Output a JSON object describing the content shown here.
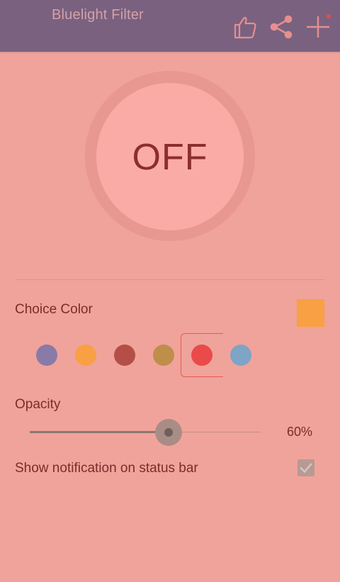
{
  "app": {
    "title": "Bluelight Filter"
  },
  "toolbar": {
    "actions": [
      {
        "name": "like-icon",
        "label": ""
      },
      {
        "name": "share-icon",
        "label": ""
      },
      {
        "name": "add-icon",
        "label": ""
      }
    ]
  },
  "power": {
    "state_label": "OFF"
  },
  "color": {
    "section_label": "Choice Color",
    "selected_color": "#f8a043",
    "options": [
      {
        "name": "purple",
        "hex": "#8a7aa8"
      },
      {
        "name": "orange",
        "hex": "#f8a043"
      },
      {
        "name": "brick",
        "hex": "#b44f48"
      },
      {
        "name": "ochre",
        "hex": "#be8e4b"
      },
      {
        "name": "red",
        "hex": "#ea4a4a",
        "focused": true
      },
      {
        "name": "blue",
        "hex": "#7ea4c6"
      }
    ]
  },
  "opacity": {
    "section_label": "Opacity",
    "value_label": "60%",
    "value": 0.6
  },
  "notification": {
    "label": "Show notification on status bar",
    "checked": true
  },
  "theme": {
    "appbar": "#7a6180",
    "background": "#f0a39a",
    "text": "#7a2c2c"
  }
}
